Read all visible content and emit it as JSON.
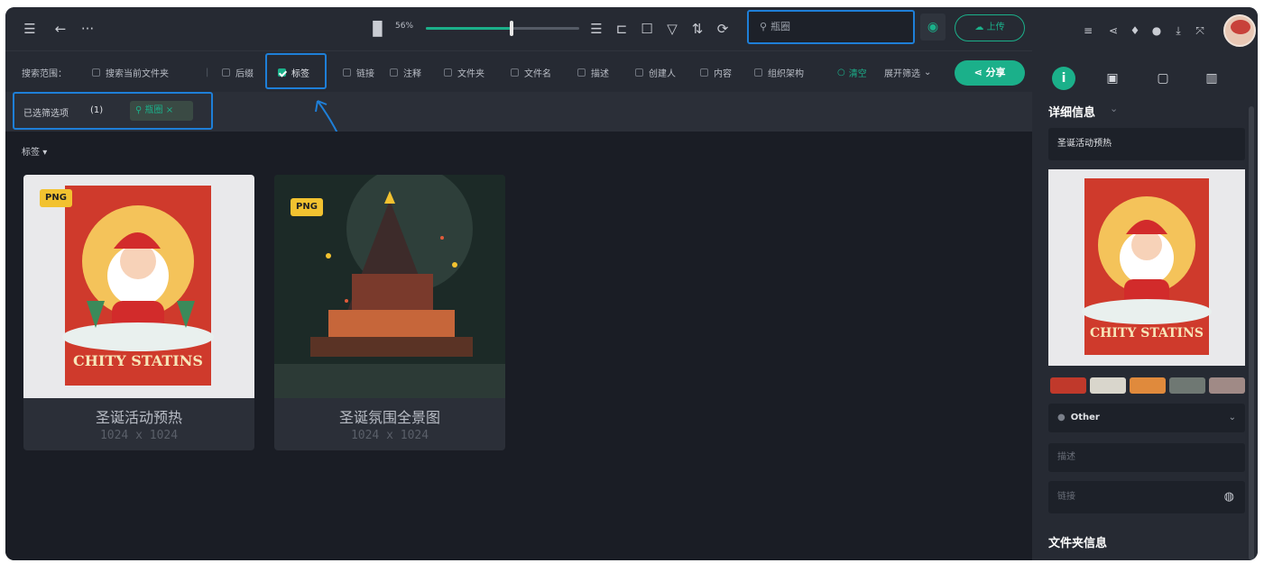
{
  "topbar": {
    "menu_icon": "menu-icon",
    "zoom_label": "56%",
    "zoom_value": 0.56,
    "search_placeholder": "瓶圈",
    "upload_label": "上传"
  },
  "filterbar": {
    "range_label": "搜索范围：",
    "items": [
      {
        "label": "搜索当前文件夹",
        "checked": false
      },
      {
        "label": "后缀",
        "checked": false
      },
      {
        "label": "标签",
        "checked": true
      },
      {
        "label": "链接",
        "checked": false
      },
      {
        "label": "注释",
        "checked": false
      },
      {
        "label": "文件夹",
        "checked": false
      },
      {
        "label": "文件名",
        "checked": false
      },
      {
        "label": "描述",
        "checked": false
      },
      {
        "label": "创建人",
        "checked": false
      },
      {
        "label": "内容",
        "checked": false
      },
      {
        "label": "组织架构",
        "checked": false
      }
    ],
    "clear_label": "清空",
    "expand_label": "展开筛选",
    "share_label": "分享"
  },
  "selected": {
    "label": "已选筛选项",
    "count": "(1)",
    "chip": "瓶圈"
  },
  "content": {
    "group_label": "标签",
    "cards": [
      {
        "title": "圣诞活动预热",
        "dims": "1024 x 1024",
        "badge": "PNG"
      },
      {
        "title": "圣诞氛围全景图",
        "dims": "1024 x 1024",
        "badge": "PNG"
      }
    ]
  },
  "poster_text": "CHITY STATINS",
  "rightpanel": {
    "details_title": "详细信息",
    "name_value": "圣诞活动预热",
    "swatches": [
      "#c0392b",
      "#d9d6cc",
      "#e08a3c",
      "#6f7873",
      "#a08a86"
    ],
    "category_value": "Other",
    "desc_placeholder": "描述",
    "link_placeholder": "链接",
    "folder_title": "文件夹信息"
  }
}
